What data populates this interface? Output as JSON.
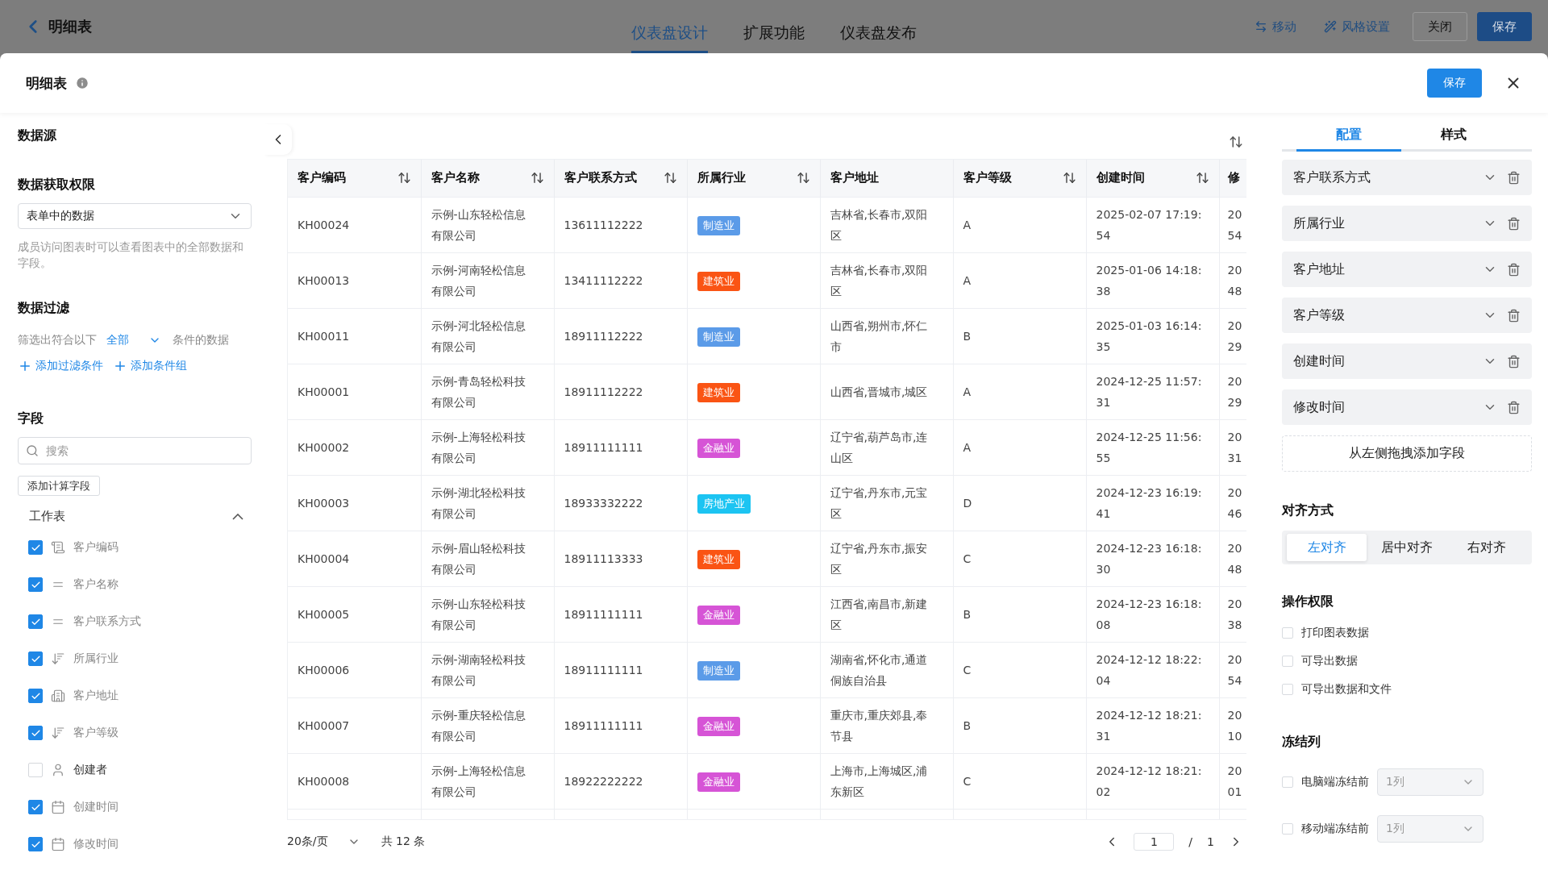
{
  "topbar": {
    "back_title": "明细表",
    "tabs": [
      {
        "label": "仪表盘设计",
        "selected": true
      },
      {
        "label": "扩展功能",
        "selected": false
      },
      {
        "label": "仪表盘发布",
        "selected": false
      }
    ],
    "actions": [
      {
        "label": "移动",
        "kind": "move"
      },
      {
        "label": "风格设置",
        "kind": "style"
      }
    ],
    "buttons": [
      {
        "label": "关闭",
        "kind": "plain"
      },
      {
        "label": "保存",
        "kind": "primary"
      }
    ]
  },
  "modal": {
    "title": "明细表",
    "save": "保存"
  },
  "left": {
    "datasource_title": "数据源",
    "permission_title": "数据获取权限",
    "permission_value": "表单中的数据",
    "permission_hint": "成员访问图表时可以查看图表中的全部数据和字段。",
    "filter_title": "数据过滤",
    "filter_prefix": "筛选出符合以下",
    "filter_value": "全部",
    "filter_suffix": "条件的数据",
    "filter_links": [
      "添加过滤条件",
      "添加条件组"
    ],
    "fields_title": "字段",
    "search_placeholder": "搜索",
    "calc_button": "添加计算字段",
    "group": {
      "label": "工作表",
      "expanded": true
    },
    "fields": [
      {
        "label": "客户编码",
        "checked": true,
        "kind": "id"
      },
      {
        "label": "客户名称",
        "checked": true,
        "kind": "text"
      },
      {
        "label": "客户联系方式",
        "checked": true,
        "kind": "text"
      },
      {
        "label": "所属行业",
        "checked": true,
        "kind": "sort"
      },
      {
        "label": "客户地址",
        "checked": true,
        "kind": "address"
      },
      {
        "label": "客户等级",
        "checked": true,
        "kind": "sort"
      },
      {
        "label": "创建者",
        "checked": false,
        "kind": "user"
      },
      {
        "label": "创建时间",
        "checked": true,
        "kind": "date"
      },
      {
        "label": "修改时间",
        "checked": true,
        "kind": "date"
      }
    ]
  },
  "table": {
    "columns": [
      {
        "label": "客户编码",
        "sortable": true
      },
      {
        "label": "客户名称",
        "sortable": true
      },
      {
        "label": "客户联系方式",
        "sortable": true
      },
      {
        "label": "所属行业",
        "sortable": true
      },
      {
        "label": "客户地址",
        "sortable": false
      },
      {
        "label": "客户等级",
        "sortable": true
      },
      {
        "label": "创建时间",
        "sortable": true
      },
      {
        "label": "修",
        "sortable": false
      }
    ],
    "rows": [
      {
        "code": "KH00024",
        "name": "示例-山东轻松信息有限公司",
        "phone": "13611112222",
        "industry": {
          "label": "制造业",
          "color": "#5b9be8"
        },
        "address": "吉林省,长春市,双阳区",
        "level": "A",
        "created": "2025-02-07 17:19:54",
        "modified": [
          "20",
          "54"
        ]
      },
      {
        "code": "KH00013",
        "name": "示例-河南轻松信息有限公司",
        "phone": "13411112222",
        "industry": {
          "label": "建筑业",
          "color": "#fa5414"
        },
        "address": "吉林省,长春市,双阳区",
        "level": "A",
        "created": "2025-01-06 14:18:38",
        "modified": [
          "20",
          "48"
        ]
      },
      {
        "code": "KH00011",
        "name": "示例-河北轻松信息有限公司",
        "phone": "18911112222",
        "industry": {
          "label": "制造业",
          "color": "#5b9be8"
        },
        "address": "山西省,朔州市,怀仁市",
        "level": "B",
        "created": "2025-01-03 16:14:35",
        "modified": [
          "20",
          "29"
        ]
      },
      {
        "code": "KH00001",
        "name": "示例-青岛轻松科技有限公司",
        "phone": "18911112222",
        "industry": {
          "label": "建筑业",
          "color": "#fa5414"
        },
        "address": "山西省,晋城市,城区",
        "level": "A",
        "created": "2024-12-25 11:57:31",
        "modified": [
          "20",
          "29"
        ]
      },
      {
        "code": "KH00002",
        "name": "示例-上海轻松科技有限公司",
        "phone": "18911111111",
        "industry": {
          "label": "金融业",
          "color": "#d654d6"
        },
        "address": "辽宁省,葫芦岛市,连山区",
        "level": "A",
        "created": "2024-12-25 11:56:55",
        "modified": [
          "20",
          "31"
        ]
      },
      {
        "code": "KH00003",
        "name": "示例-湖北轻松科技有限公司",
        "phone": "18933332222",
        "industry": {
          "label": "房地产业",
          "color": "#1cc4f2"
        },
        "address": "辽宁省,丹东市,元宝区",
        "level": "D",
        "created": "2024-12-23 16:19:41",
        "modified": [
          "20",
          "46"
        ]
      },
      {
        "code": "KH00004",
        "name": "示例-眉山轻松科技有限公司",
        "phone": "18911113333",
        "industry": {
          "label": "建筑业",
          "color": "#fa5414"
        },
        "address": "辽宁省,丹东市,振安区",
        "level": "C",
        "created": "2024-12-23 16:18:30",
        "modified": [
          "20",
          "48"
        ]
      },
      {
        "code": "KH00005",
        "name": "示例-山东轻松科技有限公司",
        "phone": "18911111111",
        "industry": {
          "label": "金融业",
          "color": "#d654d6"
        },
        "address": "江西省,南昌市,新建区",
        "level": "B",
        "created": "2024-12-23 16:18:08",
        "modified": [
          "20",
          "38"
        ]
      },
      {
        "code": "KH00006",
        "name": "示例-湖南轻松科技有限公司",
        "phone": "18911111111",
        "industry": {
          "label": "制造业",
          "color": "#5b9be8"
        },
        "address": "湖南省,怀化市,通道侗族自治县",
        "level": "C",
        "created": "2024-12-12 18:22:04",
        "modified": [
          "20",
          "54"
        ]
      },
      {
        "code": "KH00007",
        "name": "示例-重庆轻松信息有限公司",
        "phone": "18911111111",
        "industry": {
          "label": "金融业",
          "color": "#d654d6"
        },
        "address": "重庆市,重庆郊县,奉节县",
        "level": "B",
        "created": "2024-12-12 18:21:31",
        "modified": [
          "20",
          "10"
        ]
      },
      {
        "code": "KH00008",
        "name": "示例-上海轻松信息有限公司",
        "phone": "18922222222",
        "industry": {
          "label": "金融业",
          "color": "#d654d6"
        },
        "address": "上海市,上海城区,浦东新区",
        "level": "C",
        "created": "2024-12-12 18:21:02",
        "modified": [
          "20",
          "01"
        ]
      }
    ],
    "page_size": "20条/页",
    "total": "共 12 条",
    "page": "1",
    "page_sep": "/",
    "pages": "1"
  },
  "right": {
    "tabs": [
      {
        "label": "配置",
        "selected": true
      },
      {
        "label": "样式",
        "selected": false
      }
    ],
    "fields": [
      "客户联系方式",
      "所属行业",
      "客户地址",
      "客户等级",
      "创建时间",
      "修改时间"
    ],
    "drop_hint": "从左侧拖拽添加字段",
    "align_title": "对齐方式",
    "align": [
      {
        "label": "左对齐",
        "selected": true
      },
      {
        "label": "居中对齐",
        "selected": false
      },
      {
        "label": "右对齐",
        "selected": false
      }
    ],
    "perm_title": "操作权限",
    "perms": [
      {
        "label": "打印图表数据",
        "checked": false
      },
      {
        "label": "可导出数据",
        "checked": false
      },
      {
        "label": "可导出数据和文件",
        "checked": false
      }
    ],
    "freeze_title": "冻结列",
    "freeze": [
      {
        "label": "电脑端冻结前",
        "checked": false,
        "value": "1列"
      },
      {
        "label": "移动端冻结前",
        "checked": false,
        "value": "1列"
      }
    ]
  }
}
